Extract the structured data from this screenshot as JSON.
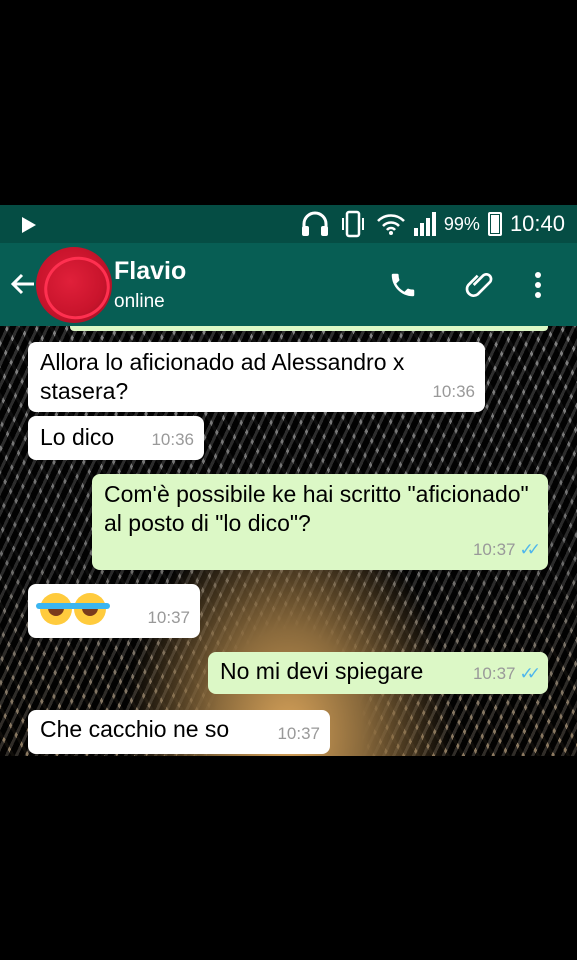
{
  "status_bar": {
    "battery_percent": "99%",
    "time": "10:40"
  },
  "header": {
    "contact_name": "Flavio",
    "contact_status": "online"
  },
  "messages": [
    {
      "direction": "in",
      "text": "Allora lo aficionado ad Alessandro x stasera?",
      "time": "10:36"
    },
    {
      "direction": "in",
      "text": "Lo dico",
      "time": "10:36"
    },
    {
      "direction": "out",
      "text": "Com'è possibile ke hai scritto \"aficionado\" al posto di \"lo dico\"?",
      "time": "10:37",
      "read": true
    },
    {
      "direction": "in",
      "text": "",
      "emoji": [
        "face-with-tears-of-joy",
        "face-with-tears-of-joy"
      ],
      "time": "10:37"
    },
    {
      "direction": "out",
      "text": "No mi devi spiegare",
      "time": "10:37",
      "read": true
    },
    {
      "direction": "in",
      "text": "Che cacchio ne so",
      "time": "10:37"
    }
  ],
  "colors": {
    "status_bar": "#054d44",
    "header": "#075e54",
    "outgoing_bubble": "#dcf8c6",
    "incoming_bubble": "#ffffff",
    "read_ticks": "#4fb6ec"
  }
}
